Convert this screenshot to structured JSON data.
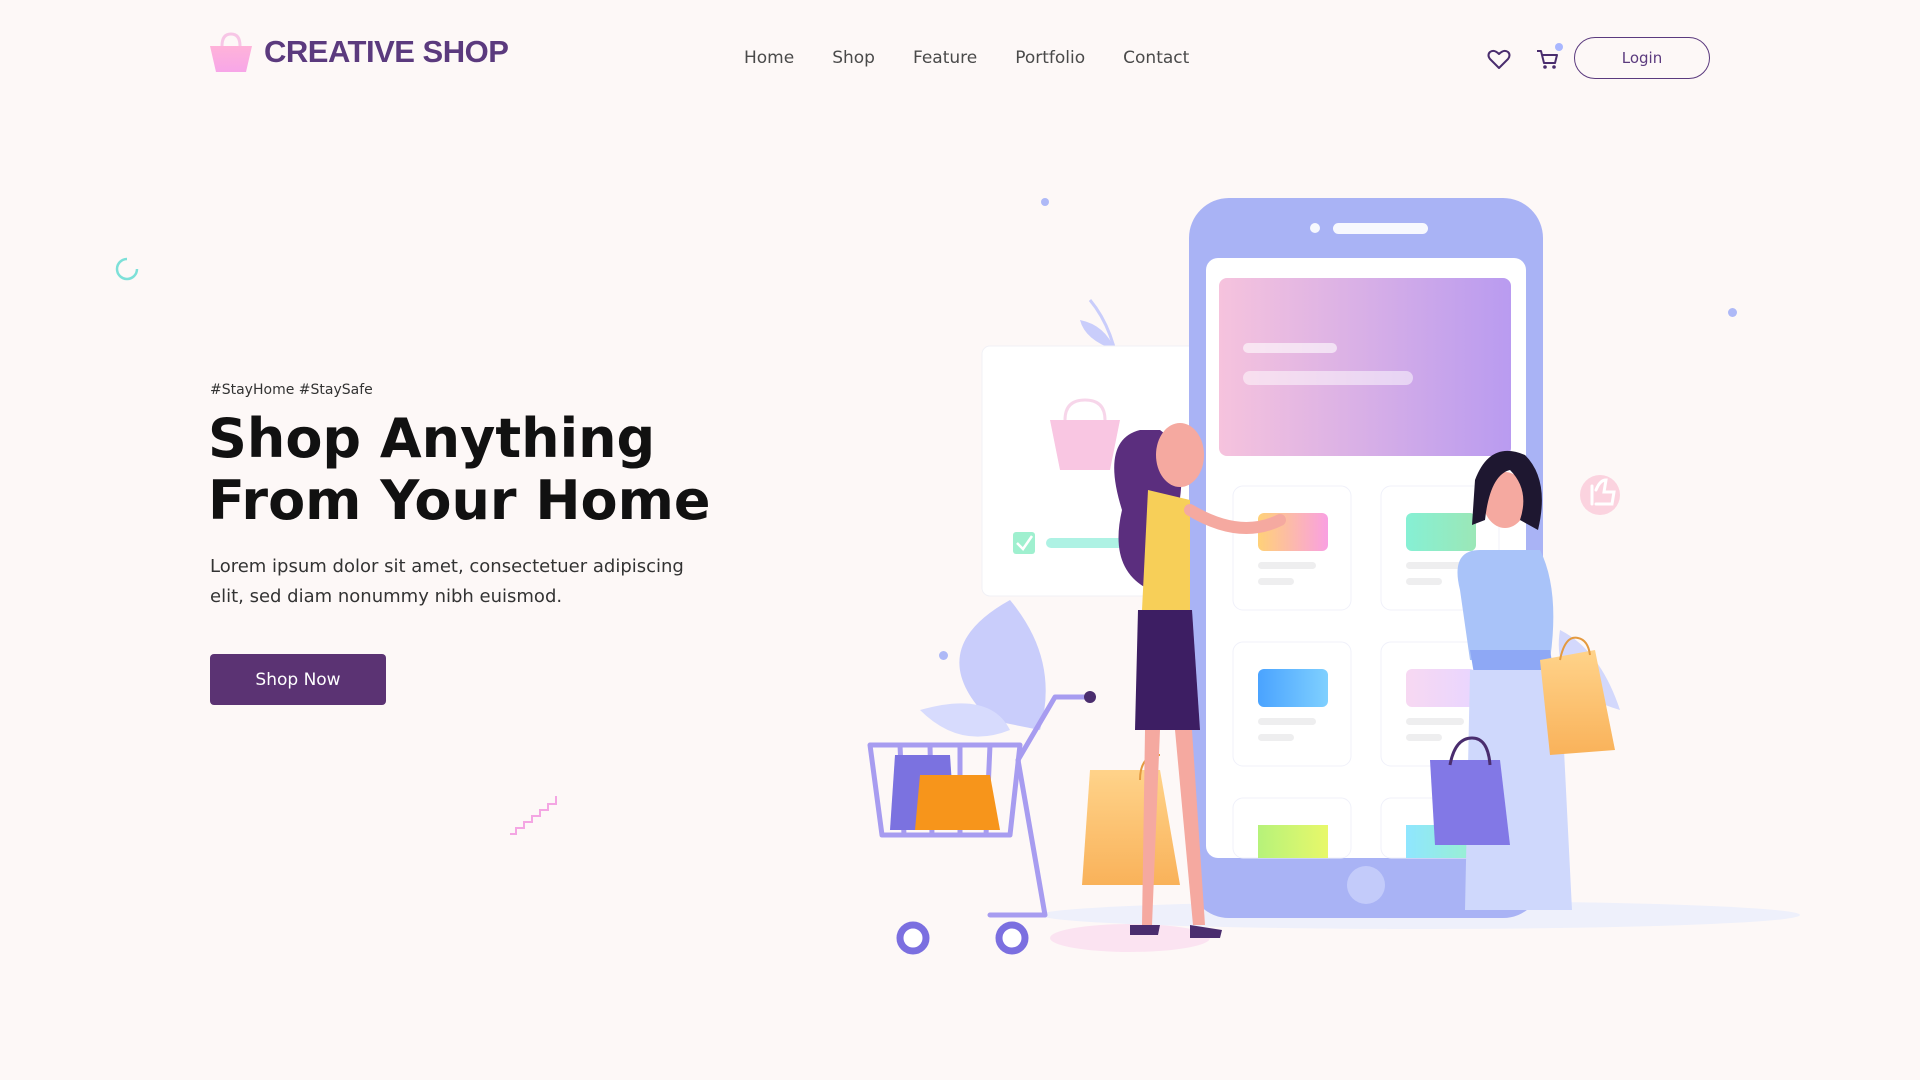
{
  "header": {
    "brand": "CREATIVE SHOP",
    "nav": [
      "Home",
      "Shop",
      "Feature",
      "Portfolio",
      "Contact"
    ],
    "login_label": "Login",
    "icons": [
      "heart-icon",
      "cart-icon"
    ]
  },
  "hero": {
    "tagline": "#StayHome #StaySafe",
    "headline": "Shop Anything From Your Home",
    "description": "Lorem ipsum dolor sit amet, consectetuer adipiscing elit, sed diam nonummy nibh euismod.",
    "cta_label": "Shop Now"
  },
  "colors": {
    "brand": "#5b3a7e",
    "button": "#5b3373",
    "background": "#fdf8f7",
    "phone": "#a9b3f5"
  }
}
